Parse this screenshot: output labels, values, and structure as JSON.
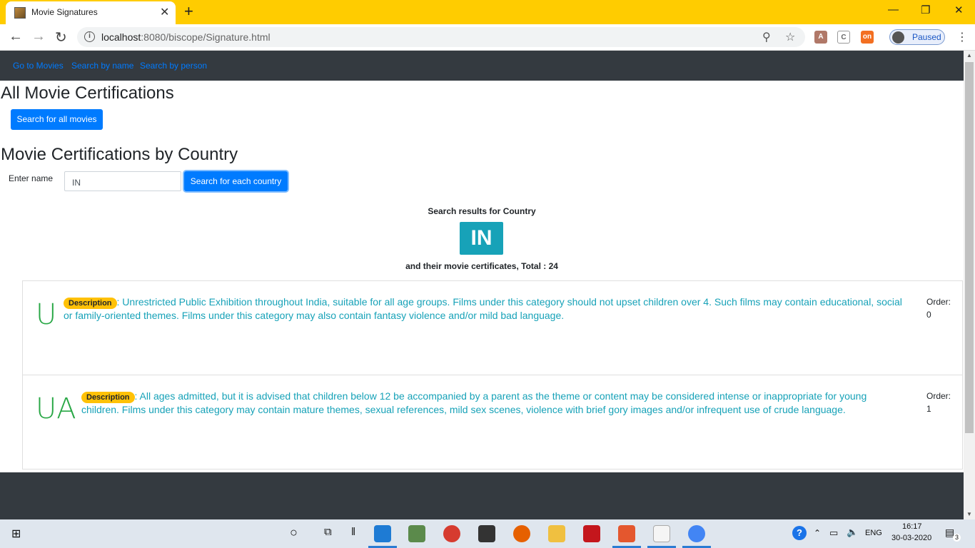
{
  "browser": {
    "tab_title": "Movie Signatures",
    "url_host": "localhost",
    "url_rest": ":8080/biscope/Signature.html",
    "profile_label": "Paused",
    "new_tab_icon": "+",
    "close_icon": "✕"
  },
  "nav": {
    "links": [
      "Go to Movies",
      "Search by name",
      "Search by person"
    ]
  },
  "sections": {
    "all_title": "All Movie Certifications",
    "all_button": "Search for all movies",
    "country_title": "Movie Certifications by Country",
    "name_label": "Enter name",
    "name_value": "IN",
    "country_button": "Search for each country"
  },
  "results": {
    "heading": "Search results for Country",
    "country": "IN",
    "total_text": "and their movie certificates, Total : 24"
  },
  "certificates": [
    {
      "code": "U",
      "badge": "Description",
      "text": ": Unrestricted Public Exhibition throughout India, suitable for all age groups. Films under this category should not upset children over 4. Such films may contain educational, social or family-oriented themes. Films under this category may also contain fantasy violence and/or mild bad language.",
      "order_label": "Order:",
      "order_value": "0"
    },
    {
      "code": "UA",
      "badge": "Description",
      "text": ": All ages admitted, but it is advised that children below 12 be accompanied by a parent as the theme or content may be considered intense or inappropriate for young children. Films under this category may contain mature themes, sexual references, mild sex scenes, violence with brief gory images and/or infrequent use of crude language.",
      "order_label": "Order:",
      "order_value": "1"
    }
  ],
  "taskbar": {
    "language": "ENG",
    "time": "16:17",
    "date": "30-03-2020",
    "notification_count": "3"
  },
  "colors": {
    "tabstrip": "#ffcc00",
    "navbar": "#343a40",
    "primary": "#007bff",
    "info": "#17a2b8",
    "success": "#28a745",
    "warning": "#ffc107"
  }
}
